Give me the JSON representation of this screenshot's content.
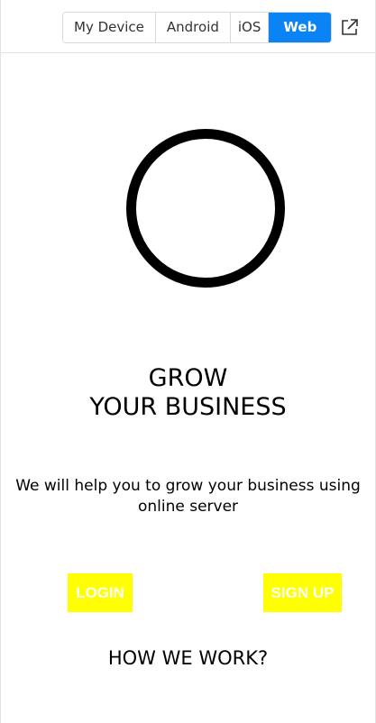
{
  "toolbar": {
    "options": [
      "My Device",
      "Android",
      "iOS",
      "Web"
    ],
    "selected": "Web",
    "accent": "#0a84f5"
  },
  "icons": {
    "external_link": "external-link-icon"
  },
  "hero": {
    "title_line1": "GROW",
    "title_line2": "YOUR BUSINESS",
    "subtitle": "We will help you to grow your business using online server"
  },
  "actions": {
    "login_label": "LOGIN",
    "signup_label": "SIGN UP",
    "button_color": "#ffff00"
  },
  "footer": {
    "how_label": "HOW WE WORK?"
  }
}
